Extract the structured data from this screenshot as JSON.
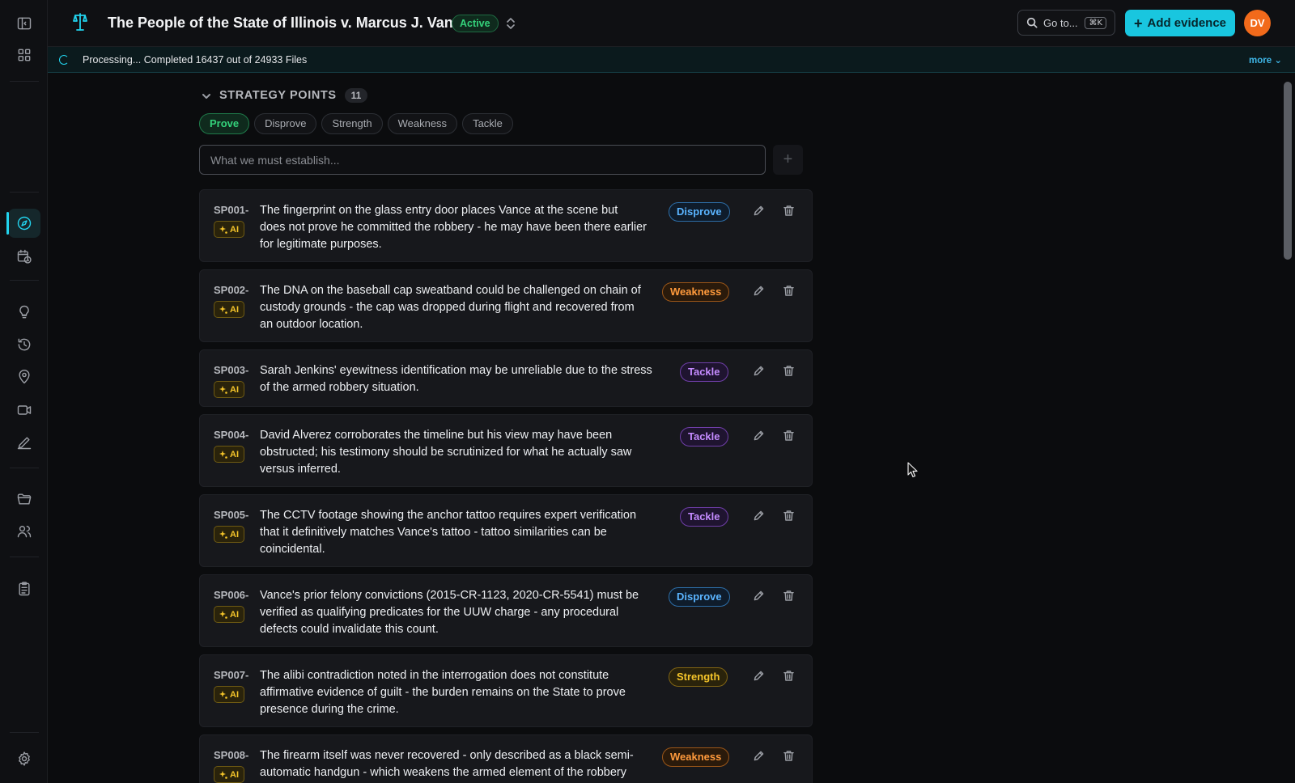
{
  "header": {
    "case_title": "The People of the State of Illinois v. Marcus J. Vance",
    "status": "Active",
    "goto_label": "Go to...",
    "goto_shortcut": "⌘K",
    "add_evidence_label": "Add evidence",
    "avatar_initials": "DV"
  },
  "processing": {
    "text": "Processing... Completed 16437 out of 24933 Files",
    "more_label": "more"
  },
  "strategy": {
    "section_title": "STRATEGY POINTS",
    "count": "11",
    "filters": [
      "Prove",
      "Disprove",
      "Strength",
      "Weakness",
      "Tackle"
    ],
    "active_filter": "Prove",
    "input_placeholder": "What we must establish...",
    "ai_label": "AI",
    "points": [
      {
        "id": "SP001-",
        "tag": "Disprove",
        "lines": [
          "The fingerprint on the glass entry door places Vance at the scene but",
          "does not prove he committed the robbery - he may have been there earlier",
          "for legitimate purposes."
        ]
      },
      {
        "id": "SP002-",
        "tag": "Weakness",
        "lines": [
          "The DNA on the baseball cap sweatband could be challenged on chain of",
          "custody grounds - the cap was dropped during flight and recovered from",
          "an outdoor location."
        ]
      },
      {
        "id": "SP003-",
        "tag": "Tackle",
        "lines": [
          "Sarah Jenkins' eyewitness identification may be unreliable due to the stress",
          "of the armed robbery situation."
        ]
      },
      {
        "id": "SP004-",
        "tag": "Tackle",
        "lines": [
          "David Alverez corroborates the timeline but his view may have been",
          "obstructed; his testimony should be scrutinized for what he actually saw",
          "versus inferred."
        ]
      },
      {
        "id": "SP005-",
        "tag": "Tackle",
        "lines": [
          "The CCTV footage showing the anchor tattoo requires expert verification",
          "that it definitively matches Vance's tattoo - tattoo similarities can be",
          "coincidental."
        ]
      },
      {
        "id": "SP006-",
        "tag": "Disprove",
        "lines": [
          "Vance's prior felony convictions (2015-CR-1123, 2020-CR-5541) must be",
          "verified as qualifying predicates for the UUW charge - any procedural",
          "defects could invalidate this count."
        ]
      },
      {
        "id": "SP007-",
        "tag": "Strength",
        "lines": [
          "The alibi contradiction noted in the interrogation does not constitute",
          "affirmative evidence of guilt - the burden remains on the State to prove",
          "presence during the crime."
        ]
      },
      {
        "id": "SP008-",
        "tag": "Weakness",
        "lines": [
          "The firearm itself was never recovered - only described as a black semi-",
          "automatic handgun - which weakens the armed element of the robbery"
        ]
      }
    ]
  },
  "colors": {
    "accent": "#22d3ee",
    "active_green": "#34d27b",
    "disprove_blue": "#5ab4ff",
    "weakness_orange": "#ff9a3c",
    "tackle_purple": "#c58bff",
    "strength_gold": "#f5c52a",
    "avatar_orange": "#f26a1b"
  },
  "icons": {
    "rail": [
      "sidebar-toggle-icon",
      "grid-icon",
      "compass-icon",
      "calendar-clock-icon",
      "lightbulb-icon",
      "history-icon",
      "map-pin-icon",
      "video-icon",
      "pen-icon",
      "folder-icon",
      "users-icon",
      "clipboard-icon",
      "settings-icon"
    ]
  }
}
